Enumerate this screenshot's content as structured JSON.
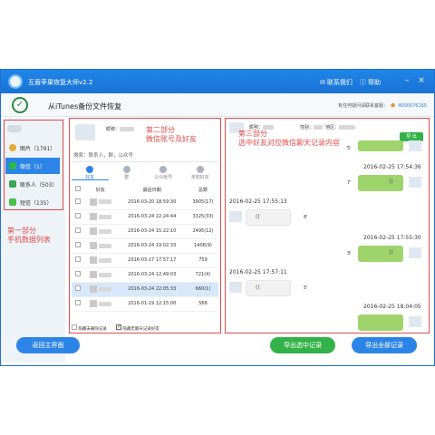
{
  "app": {
    "title": "互盾苹果恢复大师v2.2",
    "contact": "联系我们",
    "help": "帮助"
  },
  "toolbar": {
    "title": "从iTunes备份文件恢复",
    "support_label": "有任何疑问请联系客服：",
    "support_qq": "4000076165"
  },
  "sidebar": {
    "items": [
      {
        "label": "图片（1791）",
        "icon": "photo-icon",
        "color": "#e8a93a"
      },
      {
        "label": "微信（1）",
        "icon": "wechat-icon",
        "color": "#2db84b"
      },
      {
        "label": "联系人（503）",
        "icon": "contacts-icon",
        "color": "#3aa655"
      },
      {
        "label": "短信（135）",
        "icon": "sms-icon",
        "color": "#4bbf4b"
      }
    ]
  },
  "annotations": {
    "part1_line1": "第一部分",
    "part1_line2": "手机数据列表",
    "part2_line1": "第二部分",
    "part2_line2": "微信账号及好友",
    "part3_line1": "第三部分",
    "part3_line2": "选中好友对应微信聊天记录内容"
  },
  "friends_panel": {
    "nickname_label": "昵称：",
    "search_placeholder": "搜索：联系人，群，公众号",
    "tabs": [
      "好友",
      "群",
      "公众帐号",
      "未知好友"
    ],
    "columns": [
      "好友",
      "最后日期",
      "总数"
    ],
    "rows": [
      {
        "date": "2016-03-20 18:59:30",
        "total": "3905(17)",
        "checked": false
      },
      {
        "date": "2016-03-24 22:24:44",
        "total": "3325(33)",
        "checked": false
      },
      {
        "date": "2016-03-24 15:22:10",
        "total": "2495(12)",
        "checked": false
      },
      {
        "date": "2016-03-24 19:02:33",
        "total": "1406(9)",
        "checked": false
      },
      {
        "date": "2016-03-17 17:57:17",
        "total": "759",
        "checked": false
      },
      {
        "date": "2016-03-24 12:49:03",
        "total": "721(4)",
        "checked": false
      },
      {
        "date": "2016-03-24 22:05:33",
        "total": "660(1)",
        "checked": false
      },
      {
        "date": "2016-01-19 12:15:00",
        "total": "568",
        "checked": false
      }
    ],
    "footer_hide_deleted": "隐藏未删除记录",
    "footer_hide_empty": "隐藏无聊天记录好友"
  },
  "chat": {
    "nickname_label": "昵称：",
    "gender_label": "性别：",
    "region_label": "地区：",
    "export_small": "导 出",
    "messages": [
      {
        "side": "me",
        "time": "",
        "dur": "5'"
      },
      {
        "side": "me",
        "time": "2016-02-25 17:54:36",
        "dur": "7'"
      },
      {
        "side": "other",
        "time": "2016-02-25 17:55:13",
        "dur": "8'"
      },
      {
        "side": "me",
        "time": "2016-02-25 17:55:30",
        "dur": "3'"
      },
      {
        "side": "other",
        "time": "2016-02-25 17:57:11",
        "dur": "5'"
      },
      {
        "side": "me",
        "time": "2016-02-25 18:04:05",
        "dur": ""
      }
    ]
  },
  "buttons": {
    "back": "返回主界面",
    "export_selected": "导出选中记录",
    "export_all": "导出全部记录"
  },
  "colors": {
    "titlebar": "#1a72d4",
    "accent": "#2c85e6",
    "green": "#33b24a",
    "annotation": "#e24b4b"
  }
}
